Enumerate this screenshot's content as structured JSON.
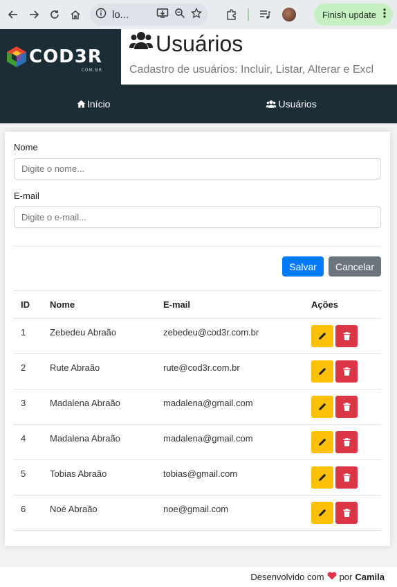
{
  "browser": {
    "url": "lo...",
    "update_label": "Finish update",
    "icons": [
      "back-icon",
      "forward-icon",
      "reload-icon",
      "home-icon",
      "info-icon",
      "install-icon",
      "zoom-icon",
      "star-icon",
      "extensions-icon",
      "media-icon",
      "kebab-icon"
    ]
  },
  "header": {
    "logo_text": "COD3R",
    "logo_sub": "COM.BR",
    "title": "Usuários",
    "subtitle": "Cadastro de usuários: Incluir, Listar, Alterar e Excl"
  },
  "nav": {
    "items": [
      {
        "label": "Início",
        "icon": "home-icon"
      },
      {
        "label": "Usuários",
        "icon": "users-icon"
      }
    ]
  },
  "form": {
    "name_label": "Nome",
    "name_placeholder": "Digite o nome...",
    "name_value": "",
    "email_label": "E-mail",
    "email_placeholder": "Digite o e-mail...",
    "email_value": "",
    "save_label": "Salvar",
    "cancel_label": "Cancelar"
  },
  "table": {
    "headers": [
      "ID",
      "Nome",
      "E-mail",
      "Ações"
    ],
    "rows": [
      {
        "id": "1",
        "name": "Zebedeu Abraão",
        "email": "zebedeu@cod3r.com.br"
      },
      {
        "id": "2",
        "name": "Rute Abraão",
        "email": "rute@cod3r.com.br"
      },
      {
        "id": "3",
        "name": "Madalena Abraão",
        "email": "madalena@gmail.com"
      },
      {
        "id": "4",
        "name": "Madalena Abraão",
        "email": "madalena@gmail.com"
      },
      {
        "id": "5",
        "name": "Tobias Abraão",
        "email": "tobias@gmail.com"
      },
      {
        "id": "6",
        "name": "Noé Abraão",
        "email": "noe@gmail.com"
      }
    ]
  },
  "footer": {
    "prefix": "Desenvolvido com",
    "by": "por",
    "author": "Camila"
  },
  "colors": {
    "primary": "#007bff",
    "secondary": "#6c757d",
    "warning": "#ffc107",
    "danger": "#dc3545",
    "dark": "#1d2d36",
    "heart": "#e0334d"
  }
}
